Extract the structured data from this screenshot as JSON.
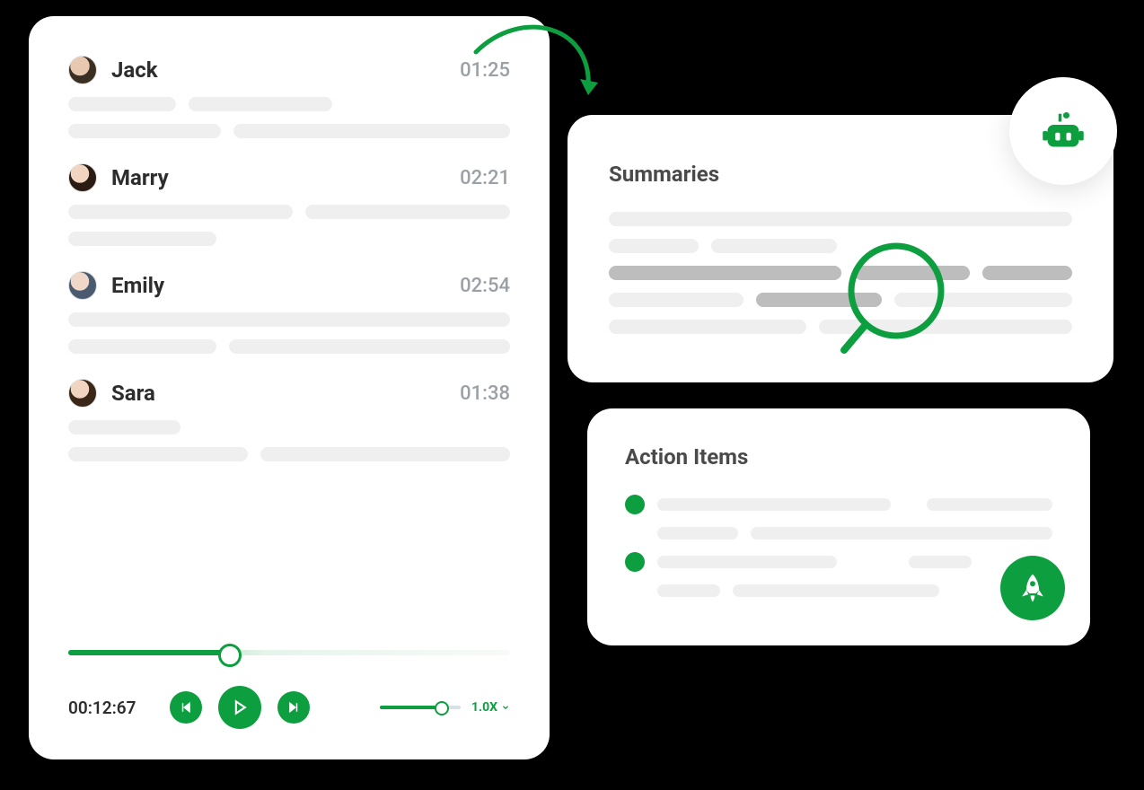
{
  "colors": {
    "accent": "#0d9f3f"
  },
  "transcript": {
    "speakers": [
      {
        "name": "Jack",
        "time": "01:25"
      },
      {
        "name": "Marry",
        "time": "02:21"
      },
      {
        "name": "Emily",
        "time": "02:54"
      },
      {
        "name": "Sara",
        "time": "01:38"
      }
    ],
    "player": {
      "elapsed": "00:12:67",
      "speed_label": "1.0X",
      "progress_pct": 35,
      "speed_pct": 70
    }
  },
  "summaries": {
    "title": "Summaries"
  },
  "action_items": {
    "title": "Action Items"
  }
}
